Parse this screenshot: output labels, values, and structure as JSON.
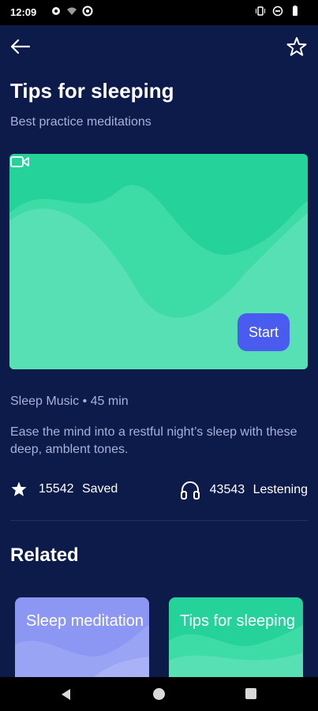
{
  "status_bar": {
    "time": "12:09",
    "left_icons": [
      "location-icon",
      "wifi-off-icon",
      "sync-icon"
    ],
    "right_icons": [
      "vibrate-icon",
      "dnd-icon",
      "battery-icon"
    ]
  },
  "app_bar": {
    "back_icon": "arrow-left-icon",
    "favorite_icon": "star-outline-icon"
  },
  "header": {
    "title": "Tips for sleeping",
    "subtitle": "Best practice meditations"
  },
  "hero": {
    "video_icon": "video-camera-icon",
    "start_label": "Start",
    "colors": {
      "base": "#25d29a",
      "mid": "#3ddba6",
      "light": "#57e0b4",
      "button": "#4a5bf0"
    }
  },
  "details": {
    "meta": "Sleep Music • 45 min",
    "description": "Ease the mind into a restful night’s sleep with these deep, amblent tones."
  },
  "stats": {
    "saved_count": "15542",
    "saved_label": "Saved",
    "listening_count": "43543",
    "listening_label": "Lestening"
  },
  "related": {
    "title": "Related",
    "cards": [
      {
        "label": "Sleep meditation",
        "color": "#8c97f3"
      },
      {
        "label": "Tips for sleeping",
        "color": "#25d29a"
      }
    ]
  },
  "nav": {
    "back_icon": "nav-back-icon",
    "home_icon": "nav-home-icon",
    "recents_icon": "nav-recents-icon"
  },
  "colors": {
    "background": "#0d1b4a",
    "muted_text": "#a7b1d9",
    "divider": "#22305f"
  }
}
